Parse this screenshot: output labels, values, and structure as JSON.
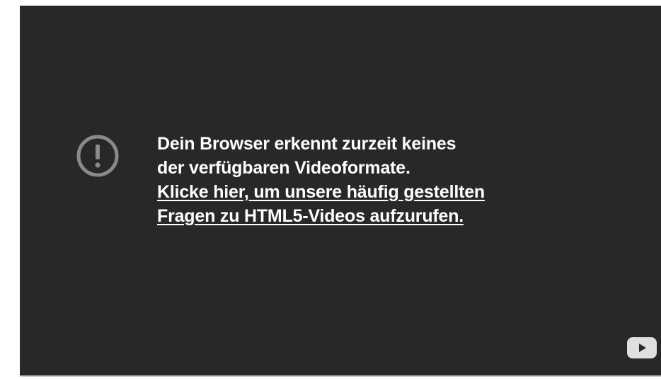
{
  "player": {
    "error": {
      "icon": "exclamation-circle-icon",
      "message_lines": [
        "Dein Browser erkennt zurzeit keines",
        "der verfügbaren Videoformate."
      ],
      "link_lines": [
        "Klicke hier, um unsere häufig gestellten",
        "Fragen zu HTML5-Videos aufzurufen."
      ]
    },
    "logo": "youtube-logo-icon"
  },
  "colors": {
    "background": "#282828",
    "text": "#ffffff",
    "icon": "#8a8a8a"
  }
}
